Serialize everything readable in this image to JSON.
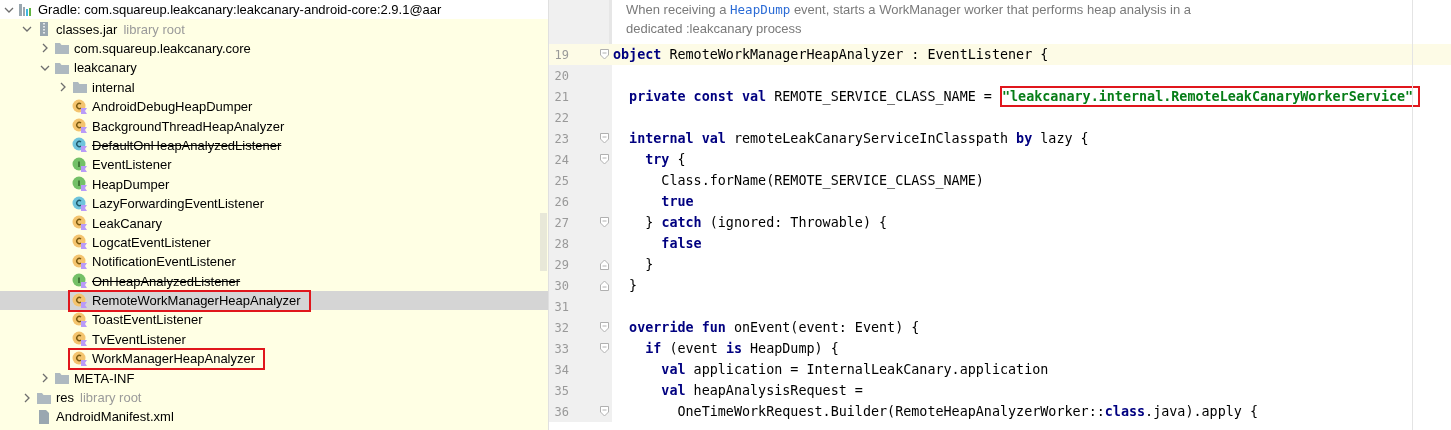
{
  "project_tree": {
    "items": [
      {
        "label": "Gradle: com.squareup.leakcanary:leakcanary-android-core:2.9.1@aar",
        "kind": "library",
        "expanded": true,
        "children": [
          {
            "label": "classes.jar",
            "suffix": "library root",
            "kind": "jar",
            "expanded": true,
            "children": [
              {
                "label": "com.squareup.leakcanary.core",
                "kind": "folder",
                "expanded": false
              },
              {
                "label": "leakcanary",
                "kind": "folder",
                "expanded": true,
                "children": [
                  {
                    "label": "internal",
                    "kind": "folder",
                    "expanded": false
                  },
                  {
                    "label": "AndroidDebugHeapDumper",
                    "kind": "object",
                    "deprecated": false,
                    "selected": false,
                    "highlighted": false
                  },
                  {
                    "label": "BackgroundThreadHeapAnalyzer",
                    "kind": "object",
                    "deprecated": false,
                    "selected": false,
                    "highlighted": false
                  },
                  {
                    "label": "DefaultOnHeapAnalyzedListener",
                    "kind": "class",
                    "deprecated": true,
                    "selected": false,
                    "highlighted": false
                  },
                  {
                    "label": "EventListener",
                    "kind": "interface",
                    "deprecated": false,
                    "selected": false,
                    "highlighted": false
                  },
                  {
                    "label": "HeapDumper",
                    "kind": "interface",
                    "deprecated": false,
                    "selected": false,
                    "highlighted": false
                  },
                  {
                    "label": "LazyForwardingEventListener",
                    "kind": "class",
                    "deprecated": false,
                    "selected": false,
                    "highlighted": false
                  },
                  {
                    "label": "LeakCanary",
                    "kind": "object",
                    "deprecated": false,
                    "selected": false,
                    "highlighted": false
                  },
                  {
                    "label": "LogcatEventListener",
                    "kind": "object",
                    "deprecated": false,
                    "selected": false,
                    "highlighted": false
                  },
                  {
                    "label": "NotificationEventListener",
                    "kind": "object",
                    "deprecated": false,
                    "selected": false,
                    "highlighted": false
                  },
                  {
                    "label": "OnHeapAnalyzedListener",
                    "kind": "interface",
                    "deprecated": true,
                    "selected": false,
                    "highlighted": false
                  },
                  {
                    "label": "RemoteWorkManagerHeapAnalyzer",
                    "kind": "object",
                    "deprecated": false,
                    "selected": true,
                    "highlighted": true
                  },
                  {
                    "label": "ToastEventListener",
                    "kind": "object",
                    "deprecated": false,
                    "selected": false,
                    "highlighted": false
                  },
                  {
                    "label": "TvEventListener",
                    "kind": "object",
                    "deprecated": false,
                    "selected": false,
                    "highlighted": false
                  },
                  {
                    "label": "WorkManagerHeapAnalyzer",
                    "kind": "object",
                    "deprecated": false,
                    "selected": false,
                    "highlighted": true
                  }
                ]
              },
              {
                "label": "META-INF",
                "kind": "folder",
                "expanded": false
              }
            ]
          },
          {
            "label": "res",
            "suffix": "library root",
            "kind": "folder",
            "expanded": false
          },
          {
            "label": "AndroidManifest.xml",
            "kind": "file"
          }
        ]
      }
    ]
  },
  "editor": {
    "doc": [
      {
        "kind": "text",
        "text": "When receiving a "
      },
      {
        "kind": "link",
        "text": "HeapDump"
      },
      {
        "kind": "text",
        "text": " event, starts a WorkManager worker that performs heap analysis in a dedicated :leakcanary process"
      }
    ],
    "lines": [
      {
        "number": "19",
        "current": true,
        "kind": "fold-start",
        "tokens": [
          {
            "kind": "keyword",
            "text": "object"
          },
          {
            "kind": "plain",
            "text": " RemoteWorkManagerHeapAnalyzer : EventListener {"
          }
        ]
      },
      {
        "number": "20",
        "current": false,
        "kind": "plain"
      },
      {
        "number": "21",
        "current": false,
        "kind": "plain",
        "tokens": [
          {
            "kind": "keyword",
            "text": "  private const val"
          },
          {
            "kind": "plain",
            "text": " REMOTE_SERVICE_CLASS_NAME = "
          },
          {
            "kind": "string",
            "text": "\"leakcanary.internal.RemoteLeakCanaryWorkerService\"",
            "highlighted": true
          }
        ]
      },
      {
        "number": "22",
        "current": false,
        "kind": "plain"
      },
      {
        "number": "23",
        "current": false,
        "kind": "fold-start",
        "tokens": [
          {
            "kind": "keyword",
            "text": "  internal val"
          },
          {
            "kind": "plain",
            "text": " remoteLeakCanaryServiceInClasspath "
          },
          {
            "kind": "keyword",
            "text": "by"
          },
          {
            "kind": "plain",
            "text": " lazy {"
          }
        ]
      },
      {
        "number": "24",
        "current": false,
        "kind": "fold-start",
        "tokens": [
          {
            "kind": "keyword",
            "text": "    try"
          },
          {
            "kind": "plain",
            "text": " {"
          }
        ]
      },
      {
        "number": "25",
        "current": false,
        "kind": "plain",
        "tokens": [
          {
            "kind": "plain",
            "text": "      Class.forName(REMOTE_SERVICE_CLASS_NAME)"
          }
        ]
      },
      {
        "number": "26",
        "current": false,
        "kind": "plain",
        "tokens": [
          {
            "kind": "keyword",
            "text": "      true"
          }
        ]
      },
      {
        "number": "27",
        "current": false,
        "kind": "fold-start",
        "tokens": [
          {
            "kind": "plain",
            "text": "    } "
          },
          {
            "kind": "keyword",
            "text": "catch"
          },
          {
            "kind": "plain",
            "text": " (ignored: Throwable) {"
          }
        ]
      },
      {
        "number": "28",
        "current": false,
        "kind": "plain",
        "tokens": [
          {
            "kind": "keyword",
            "text": "      false"
          }
        ]
      },
      {
        "number": "29",
        "current": false,
        "kind": "fold-end",
        "tokens": [
          {
            "kind": "plain",
            "text": "    }"
          }
        ]
      },
      {
        "number": "30",
        "current": false,
        "kind": "fold-end",
        "tokens": [
          {
            "kind": "plain",
            "text": "  }"
          }
        ]
      },
      {
        "number": "31",
        "current": false,
        "kind": "plain"
      },
      {
        "number": "32",
        "current": false,
        "kind": "fold-start",
        "tokens": [
          {
            "kind": "keyword",
            "text": "  override fun"
          },
          {
            "kind": "plain",
            "text": " onEvent(event: Event) {"
          }
        ]
      },
      {
        "number": "33",
        "current": false,
        "kind": "fold-start",
        "tokens": [
          {
            "kind": "keyword",
            "text": "    if"
          },
          {
            "kind": "plain",
            "text": " (event "
          },
          {
            "kind": "keyword",
            "text": "is"
          },
          {
            "kind": "plain",
            "text": " HeapDump) {"
          }
        ]
      },
      {
        "number": "34",
        "current": false,
        "kind": "plain",
        "tokens": [
          {
            "kind": "keyword",
            "text": "      val"
          },
          {
            "kind": "plain",
            "text": " application = InternalLeakCanary.application"
          }
        ]
      },
      {
        "number": "35",
        "current": false,
        "kind": "plain",
        "tokens": [
          {
            "kind": "keyword",
            "text": "      val"
          },
          {
            "kind": "plain",
            "text": " heapAnalysisRequest ="
          }
        ]
      },
      {
        "number": "36",
        "current": false,
        "kind": "fold-start",
        "tokens": [
          {
            "kind": "plain",
            "text": "        OneTimeWorkRequest.Builder(RemoteHeapAnalyzerWorker::"
          },
          {
            "kind": "keyword",
            "text": "class"
          },
          {
            "kind": "plain",
            "text": ".java).apply {"
          }
        ]
      }
    ]
  }
}
